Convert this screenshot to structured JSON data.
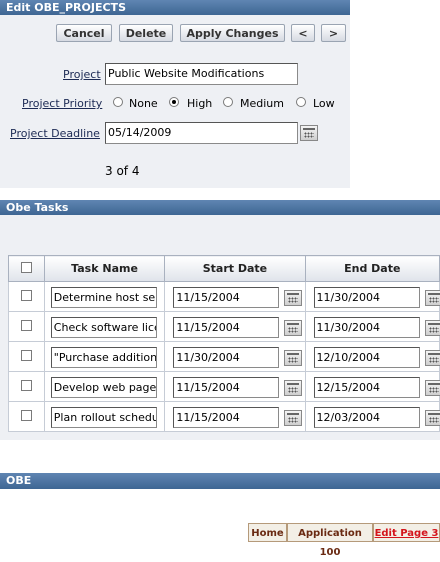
{
  "edit_region": {
    "title": "Edit OBE_PROJECTS",
    "buttons": {
      "cancel": "Cancel",
      "delete": "Delete",
      "apply": "Apply Changes",
      "prev": "<",
      "next": ">"
    },
    "project": {
      "label": "Project",
      "value": "Public Website Modifications"
    },
    "priority": {
      "label": "Project Priority",
      "options": [
        "None",
        "High",
        "Medium",
        "Low"
      ],
      "selected": "High"
    },
    "deadline": {
      "label": "Project Deadline",
      "value": "05/14/2009"
    },
    "record_position": "3 of 4"
  },
  "tasks_region": {
    "title": "Obe Tasks",
    "columns": [
      "Task Name",
      "Start Date",
      "End Date"
    ],
    "rows": [
      {
        "task": "Determine host server",
        "start": "11/15/2004",
        "end": "11/30/2004"
      },
      {
        "task": "Check software licenses",
        "start": "11/15/2004",
        "end": "11/30/2004"
      },
      {
        "task": "\"Purchase additional",
        "start": "11/30/2004",
        "end": "12/10/2004"
      },
      {
        "task": "Develop web pages",
        "start": "11/15/2004",
        "end": "12/15/2004"
      },
      {
        "task": "Plan rollout schedule",
        "start": "11/15/2004",
        "end": "12/03/2004"
      }
    ]
  },
  "footer": {
    "title": "OBE",
    "links": {
      "home": "Home",
      "application": "Application 100",
      "edit_page": "Edit Page 3"
    }
  },
  "colors": {
    "region_bar": "#4a729f",
    "current_link": "#d4141c",
    "link": "#6a2a12"
  }
}
